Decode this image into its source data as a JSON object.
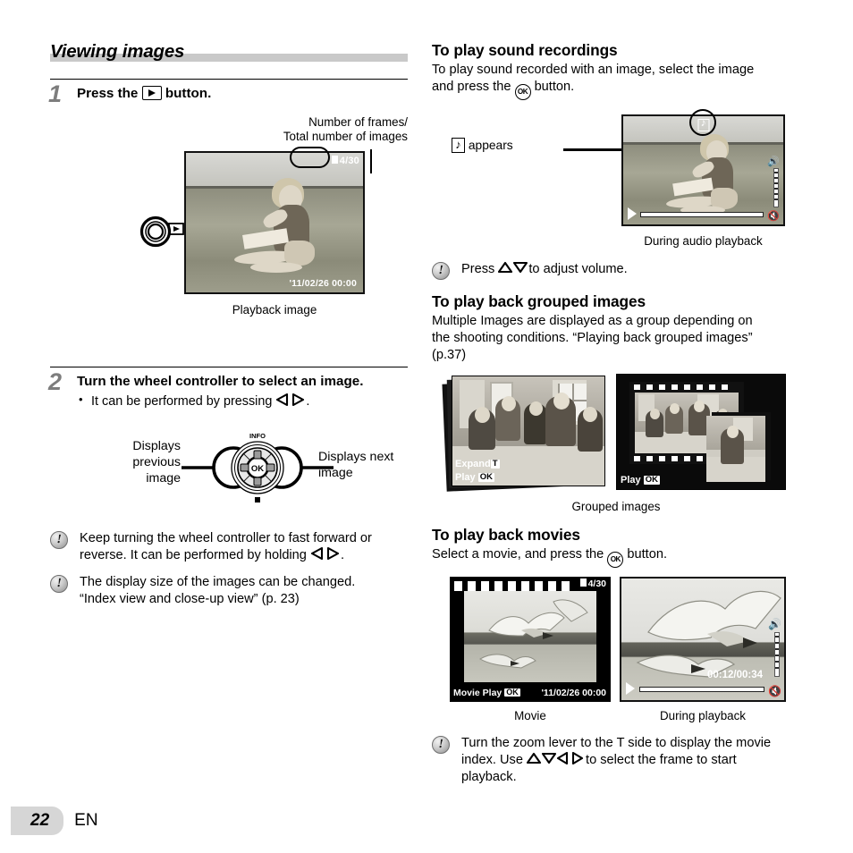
{
  "page": {
    "number": "22",
    "language": "EN"
  },
  "left": {
    "section_title": "Viewing images",
    "step1": {
      "num": "1",
      "text_before": "Press the",
      "icon": "playback-button-icon",
      "text_after": "button."
    },
    "callout_frames": "Number of frames/\nTotal number of images",
    "callout_frames_line1": "Number of frames/",
    "callout_frames_line2": "Total number of images",
    "playback_shot": {
      "frame_counter": "4/30",
      "timestamp": "'11/02/26  00:00",
      "caption": "Playback image"
    },
    "step2": {
      "num": "2",
      "head": "Turn the wheel controller to select an image.",
      "bullet_before": "It can be performed by pressing",
      "bullet_arrows": "left-right-arrow-icons",
      "bullet_after": "."
    },
    "wheel": {
      "label_left_l1": "Displays",
      "label_left_l2": "previous",
      "label_left_l3": "image",
      "label_right_l1": "Displays next",
      "label_right_l2": "image",
      "center": "OK",
      "top": "INFO"
    },
    "note1_l1": "Keep turning the wheel controller to fast forward or",
    "note1_l2_before": "reverse. It can be performed by holding",
    "note1_l2_after": ".",
    "note2_l1": "The display size of the images can be changed.",
    "note2_l2": "“Index view and close-up view” (p. 23)"
  },
  "right": {
    "sound": {
      "heading": "To play sound recordings",
      "body_l1": "To play sound recorded with an image, select the image",
      "body_l2_before": "and press the",
      "body_l2_after": "button.",
      "callout_before": "",
      "callout_after": "appears",
      "caption": "During audio playback"
    },
    "note_volume_before": "Press",
    "note_volume_after": "to adjust volume.",
    "grouped": {
      "heading": "To play back grouped images",
      "body_l1": "Multiple Images are displayed as a group depending on",
      "body_l2": "the shooting conditions. “Playing back grouped images”",
      "body_l3": "(p.37)",
      "shot_left_osd1_label": "Expand",
      "shot_left_osd1_key": "T",
      "shot_left_osd2_label": "Play",
      "shot_left_osd2_key": "OK",
      "shot_right_osd_label": "Play",
      "shot_right_osd_key": "OK",
      "caption": "Grouped images"
    },
    "movies": {
      "heading": "To play back movies",
      "body_before": "Select a movie, and press the",
      "body_after": "button.",
      "shot_left_counter": "4/30",
      "shot_left_osd_label": "Movie Play",
      "shot_left_osd_key": "OK",
      "shot_left_timestamp": "'11/02/26  00:00",
      "shot_left_caption": "Movie",
      "shot_right_time": "00:12/00:34",
      "shot_right_caption": "During playback"
    },
    "note_zoom_l1": "Turn the zoom lever to the T side to display the movie",
    "note_zoom_l2_before": "index. Use",
    "note_zoom_l2_after": "to select the frame to start",
    "note_zoom_l3": "playback."
  }
}
